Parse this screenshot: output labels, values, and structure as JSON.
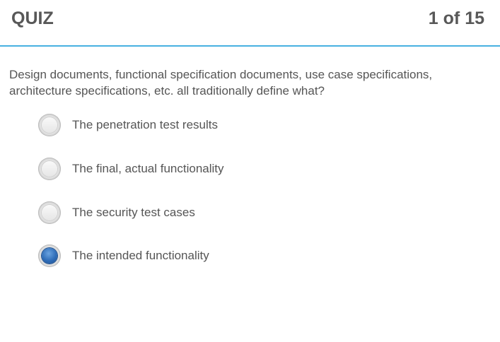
{
  "header": {
    "title": "QUIZ",
    "progress": "1 of 15"
  },
  "question": {
    "text": "Design documents, functional specification documents, use case specifications, architecture specifications, etc. all traditionally define what?"
  },
  "choices": [
    {
      "label": "The penetration test results",
      "selected": false
    },
    {
      "label": "The final, actual functionality",
      "selected": false
    },
    {
      "label": "The security test cases",
      "selected": false
    },
    {
      "label": "The intended functionality",
      "selected": true
    }
  ],
  "colors": {
    "accent_line": "#47b1e1",
    "text": "#555555",
    "title": "#585858",
    "selected_radio": "#2f6db8"
  }
}
